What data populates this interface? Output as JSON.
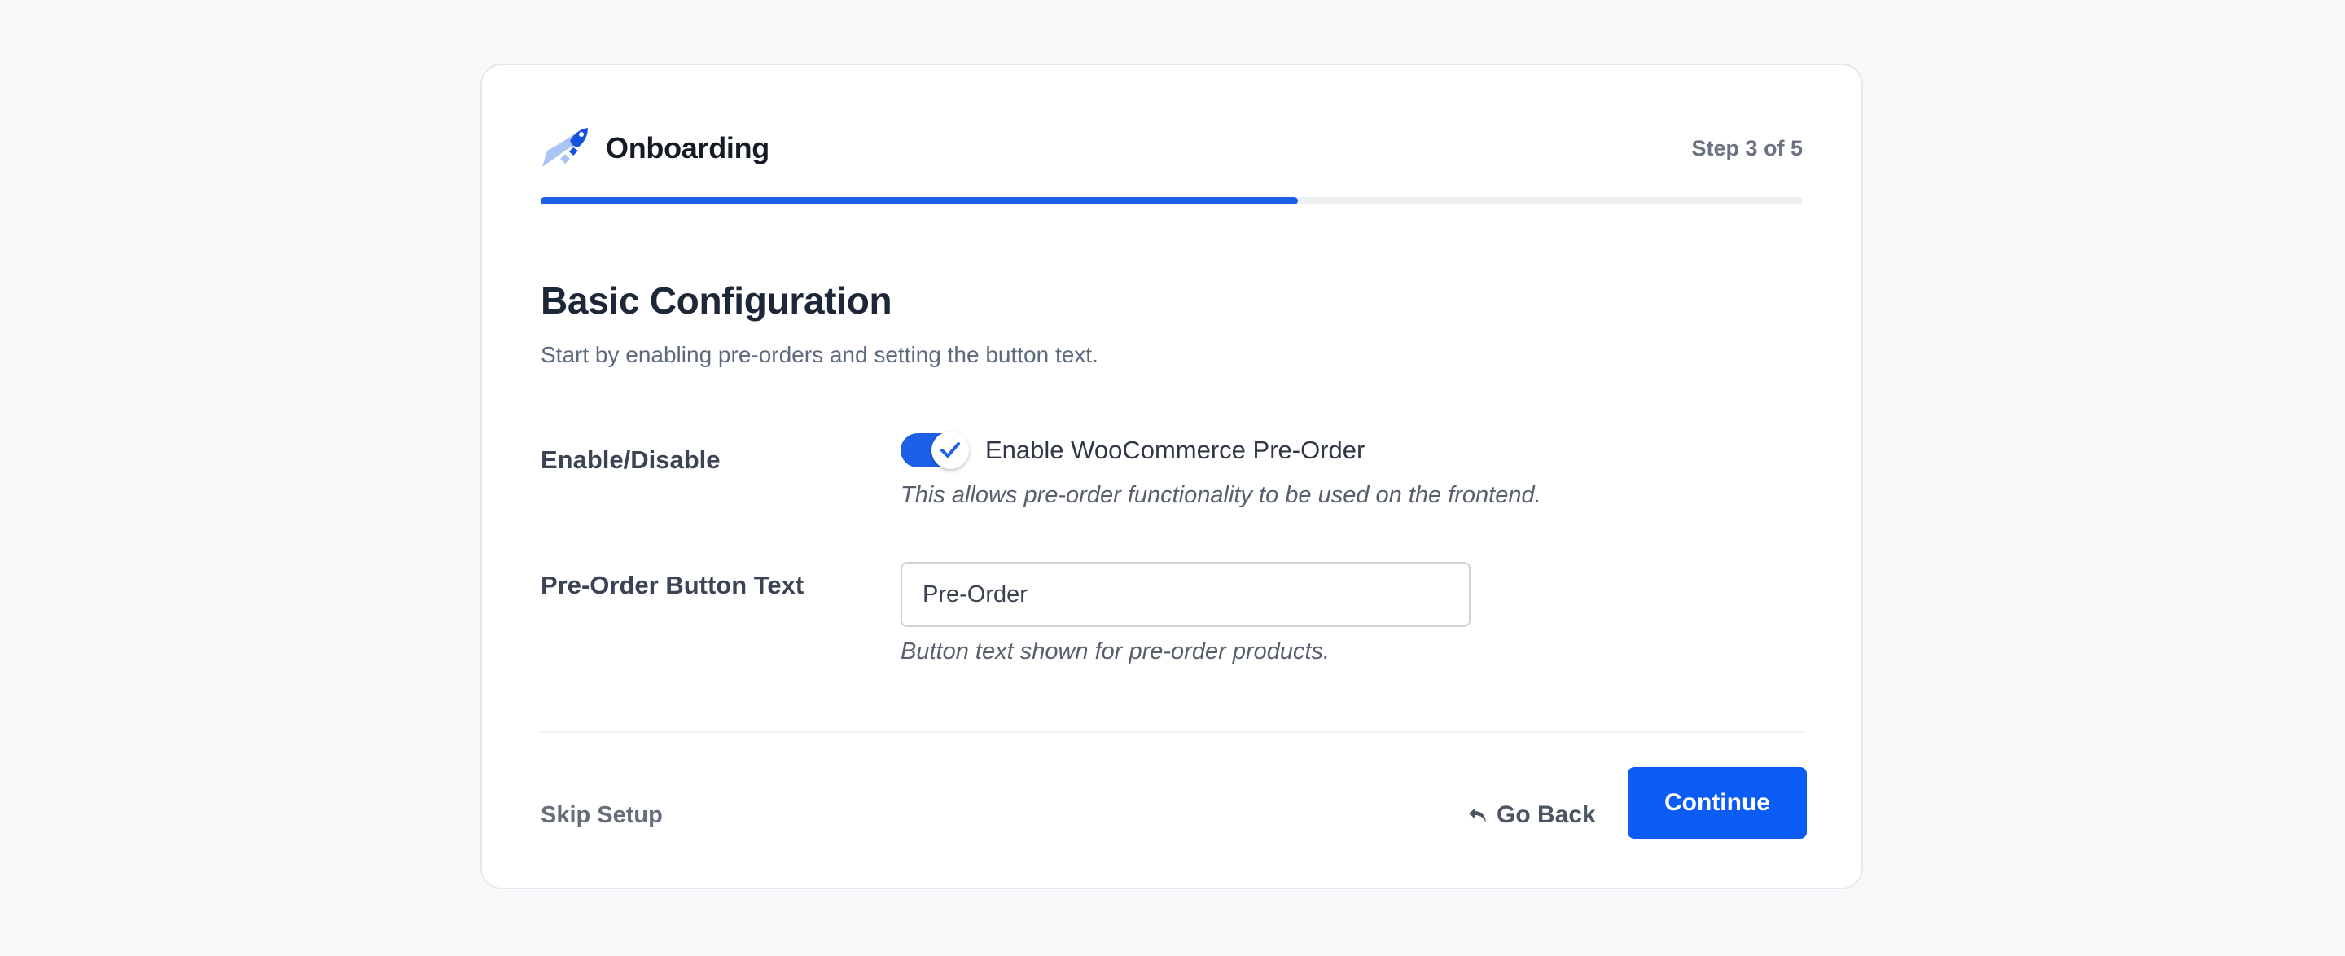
{
  "header": {
    "title": "Onboarding",
    "step_text": "Step 3 of 5",
    "logo_icon": "rocket-icon",
    "progress_fraction": 0.6
  },
  "section": {
    "title": "Basic Configuration",
    "description": "Start by enabling pre-orders and setting the button text."
  },
  "enable_setting": {
    "label": "Enable/Disable",
    "toggle_label": "Enable WooCommerce Pre-Order",
    "enabled": true,
    "help": "This allows pre-order functionality to be used on the frontend."
  },
  "button_text_setting": {
    "label": "Pre-Order Button Text",
    "value": "Pre-Order",
    "help": "Button text shown for pre-order products."
  },
  "footer": {
    "skip_label": "Skip Setup",
    "back_label": "Go Back",
    "back_icon": "reply-arrow-icon",
    "continue_label": "Continue"
  },
  "colors": {
    "accent": "#0a5cf5",
    "progress": "#1d5fe6",
    "logo_light": "#a9c4f5"
  }
}
